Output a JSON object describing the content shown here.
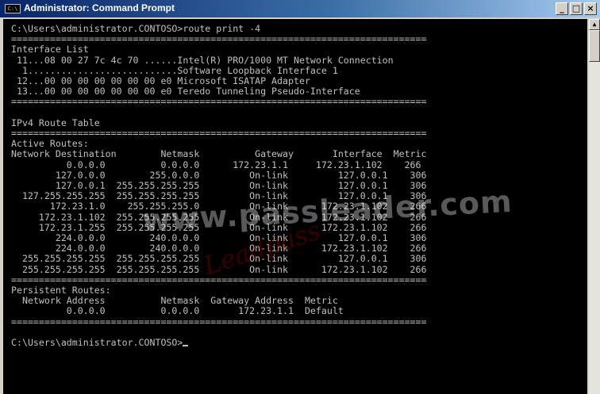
{
  "window": {
    "title": "Administrator: Command Prompt",
    "icon_label": "C:\\",
    "buttons": {
      "minimize": "_",
      "maximize": "□",
      "close": "×"
    }
  },
  "terminal": {
    "lines": [
      "C:\\Users\\administrator.CONTOSO>route print -4",
      "===========================================================================",
      "Interface List",
      " 11...08 00 27 7c 4c 70 ......Intel(R) PRO/1000 MT Network Connection",
      "  1...........................Software Loopback Interface 1",
      " 12...00 00 00 00 00 00 00 e0 Microsoft ISATAP Adapter",
      " 13...00 00 00 00 00 00 00 e0 Teredo Tunneling Pseudo-Interface",
      "===========================================================================",
      "",
      "IPv4 Route Table",
      "===========================================================================",
      "Active Routes:",
      "Network Destination        Netmask          Gateway       Interface  Metric",
      "          0.0.0.0          0.0.0.0      172.23.1.1     172.23.1.102    266",
      "        127.0.0.0        255.0.0.0         On-link         127.0.0.1    306",
      "        127.0.0.1  255.255.255.255         On-link         127.0.0.1    306",
      "  127.255.255.255  255.255.255.255         On-link         127.0.0.1    306",
      "       172.23.1.0    255.255.255.0         On-link      172.23.1.102    266",
      "     172.23.1.102  255.255.255.255         On-link      172.23.1.102    266",
      "     172.23.1.255  255.255.255.255         On-link      172.23.1.102    266",
      "        224.0.0.0        240.0.0.0         On-link         127.0.0.1    306",
      "        224.0.0.0        240.0.0.0         On-link      172.23.1.102    266",
      "  255.255.255.255  255.255.255.255         On-link         127.0.0.1    306",
      "  255.255.255.255  255.255.255.255         On-link      172.23.1.102    266",
      "===========================================================================",
      "Persistent Routes:",
      "  Network Address          Netmask  Gateway Address  Metric",
      "          0.0.0.0          0.0.0.0       172.23.1.1  Default",
      "===========================================================================",
      "",
      "C:\\Users\\administrator.CONTOSO>"
    ]
  },
  "watermark": {
    "text": "www.passleader.com",
    "secondary": "Leadpass"
  },
  "colors": {
    "console_bg": "#000000",
    "console_fg": "#c0c0c0",
    "titlebar_start": "#0a246a",
    "titlebar_end": "#a6caf0"
  }
}
